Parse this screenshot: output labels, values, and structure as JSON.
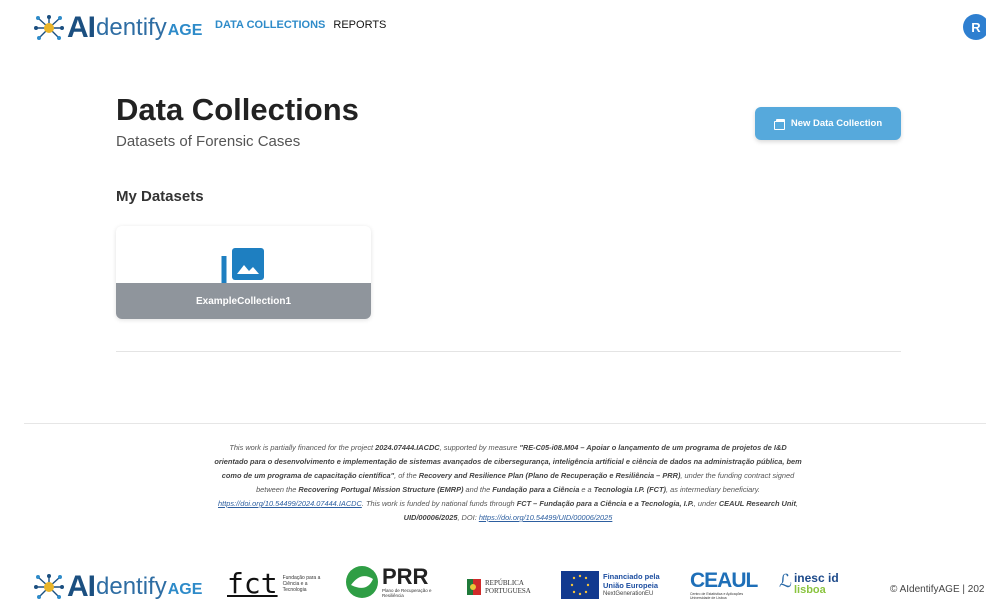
{
  "brand": {
    "ai": "AI",
    "dentify": "dentify",
    "age": "AGE"
  },
  "nav": {
    "data_collections": "DATA COLLECTIONS",
    "reports": "REPORTS"
  },
  "user": {
    "avatar_initial": "R"
  },
  "header": {
    "title": "Data Collections",
    "subtitle": "Datasets of Forensic Cases"
  },
  "actions": {
    "new_collection": "New Data Collection"
  },
  "section": {
    "my_datasets": "My Datasets"
  },
  "datasets": [
    {
      "name": "ExampleCollection1",
      "icon": "photo-library-icon"
    }
  ],
  "footer": {
    "funding": {
      "t1": "This work is partially financed for the project ",
      "b1": "2024.07444.IACDC",
      "t2": ", supported by measure ",
      "b2": "\"RE-C05-i08.M04 – Apoiar o lançamento de um programa de projetos de I&D orientado para o desenvolvimento e implementação de sistemas avançados de cibersegurança, inteligência artificial e ciência de dados na administração pública, bem como de um programa de capacitação científica\"",
      "t3": ", of the ",
      "b3": "Recovery and Resilience Plan (Plano de Recuperação e Resiliência – PRR)",
      "t4": ", under the funding contract signed between the ",
      "b4": "Recovering Portugal Mission Structure (EMRP)",
      "t5": " and the ",
      "b5": "Fundação para a Ciência",
      "t6": " e a ",
      "b6": "Tecnologia I.P. (FCT)",
      "t7": ", as intermediary beneficiary. ",
      "link1": "https://doi.org/10.54499/2024.07444.IACDC",
      "t8": ". This work is funded by national funds through ",
      "b7": "FCT – Fundação para a Ciência e a Tecnologia, I.P.",
      "t9": ", under ",
      "b8": "CEAUL Research Unit",
      "t10": ", ",
      "b9": "UID/00006/2025",
      "t11": ", DOI: ",
      "link2": "https://doi.org/10.54499/UID/00006/2025"
    },
    "logos": {
      "fct": {
        "mark": "fct",
        "text": "Fundação para a Ciência e a Tecnologia"
      },
      "prr": {
        "mark": "PRR",
        "text": "Plano de Recuperação e Resiliência"
      },
      "republica": {
        "text1": "REPÚBLICA",
        "text2": "PORTUGUESA"
      },
      "eu": {
        "line1": "Financiado pela",
        "line2": "União Europeia",
        "line3": "NextGenerationEU"
      },
      "ceaul": {
        "mark": "CEAUL",
        "text": "Centro de Estatística e Aplicações Universidade de Lisboa"
      },
      "inesc": {
        "mark": "inesc id",
        "sub": "lisboa"
      }
    },
    "copyright": "© AIdentifyAGE | 202"
  },
  "colors": {
    "accent": "#2e8bc9",
    "button": "#56a9dc",
    "brand_dark": "#1b4f80",
    "card_footer": "#8f959c"
  }
}
